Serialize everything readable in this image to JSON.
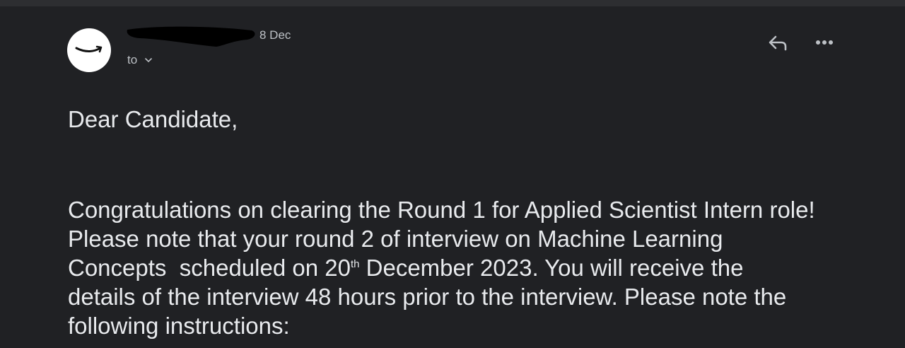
{
  "header": {
    "sender_redacted": true,
    "date": "8 Dec",
    "to_label": "to"
  },
  "icons": {
    "avatar": "amazon-smile-logo",
    "reply": "reply-icon",
    "more": "more-horizontal-icon",
    "to_expand": "chevron-down-icon"
  },
  "message": {
    "greeting": "Dear Candidate,",
    "line1": "Congratulations on clearing the Round 1 for Applied Scientist Intern role!",
    "line2": "Please note that your round 2 of interview on Machine Learning",
    "line3_a": "Concepts  scheduled on 20",
    "line3_sup": "th",
    "line3_b": " December 2023. You will receive the",
    "line4": "details of the interview 48 hours prior to the interview. Please note the",
    "line5": "following instructions:"
  }
}
